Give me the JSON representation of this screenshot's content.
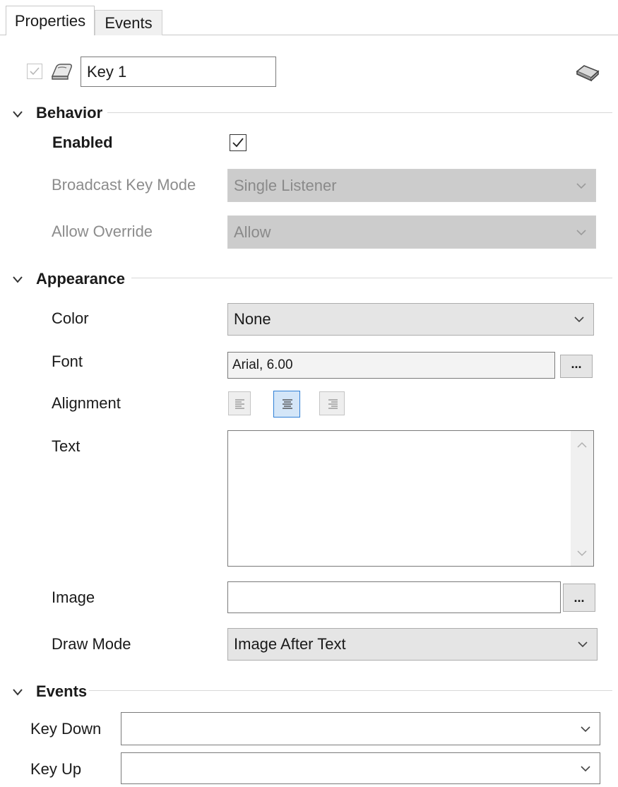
{
  "tabs": {
    "properties": "Properties",
    "events": "Events"
  },
  "header": {
    "name_value": "Key 1"
  },
  "behavior": {
    "title": "Behavior",
    "enabled_label": "Enabled",
    "enabled_checked": true,
    "broadcast_label": "Broadcast Key Mode",
    "broadcast_value": "Single Listener",
    "override_label": "Allow Override",
    "override_value": "Allow"
  },
  "appearance": {
    "title": "Appearance",
    "color_label": "Color",
    "color_value": "None",
    "font_label": "Font",
    "font_value": "Arial, 6.00",
    "font_button": "...",
    "alignment_label": "Alignment",
    "alignment_selected": "center",
    "text_label": "Text",
    "text_value": "",
    "image_label": "Image",
    "image_value": "",
    "image_button": "...",
    "drawmode_label": "Draw Mode",
    "drawmode_value": "Image After Text"
  },
  "events": {
    "title": "Events",
    "keydown_label": "Key Down",
    "keydown_value": "",
    "keyup_label": "Key Up",
    "keyup_value": ""
  },
  "icons": {
    "enable_checkbox": "check-icon",
    "object_icon": "key-icon",
    "tag_icon": "tag-icon",
    "section_toggle": "chevron-down-icon",
    "dropdown": "chevron-down-icon",
    "align_left": "align-left-icon",
    "align_center": "align-center-icon",
    "align_right": "align-right-icon"
  },
  "colors": {
    "selection_border": "#2f7fd6",
    "selection_fill": "#d4e6f8",
    "disabled_fill": "#cccccc",
    "disabled_text": "#8c8c8c"
  }
}
